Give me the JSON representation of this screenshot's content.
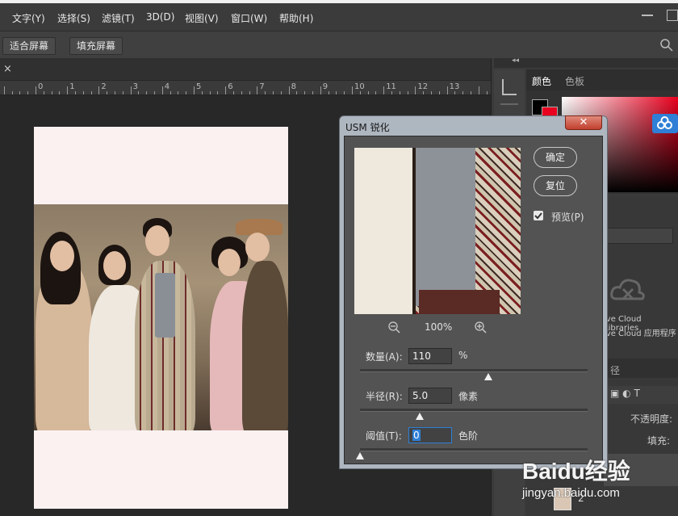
{
  "menu": [
    "文字(Y)",
    "选择(S)",
    "滤镜(T)",
    "3D(D)",
    "视图(V)",
    "窗口(W)",
    "帮助(H)"
  ],
  "options_bar": {
    "fit_screen": "适合屏幕",
    "fill_screen": "填充屏幕"
  },
  "ruler": {
    "labels": [
      "0",
      "1",
      "2",
      "3",
      "4",
      "5",
      "6",
      "7",
      "8",
      "9",
      "10",
      "11",
      "12",
      "13"
    ]
  },
  "tab_close": "×",
  "panel": {
    "tabs": [
      "颜色",
      "色板"
    ],
    "cc_libraries_line1": "ive Cloud Libraries",
    "cc_libraries_line2": "ive Cloud 应用程序",
    "layers_tab_partial": "径",
    "opacity_label": "不透明度:",
    "fill_label": "填充:",
    "layer_number": "2"
  },
  "dialog": {
    "title": "USM 锐化",
    "close": "✕",
    "ok": "确定",
    "reset": "复位",
    "preview_label": "预览(P)",
    "preview_checked": true,
    "zoom": "100%",
    "amount": {
      "label": "数量(A):",
      "value": "110",
      "unit": "%"
    },
    "radius": {
      "label": "半径(R):",
      "value": "5.0",
      "unit": "像素"
    },
    "threshold": {
      "label": "阈值(T):",
      "value": "0",
      "unit": "色阶"
    }
  },
  "watermark": {
    "brand": "Baidu经验",
    "url": "jingyan.baidu.com"
  },
  "colors": {
    "accent": "#2f7fd6",
    "close_red": "#c2402e",
    "dialog_bg": "#535353"
  }
}
